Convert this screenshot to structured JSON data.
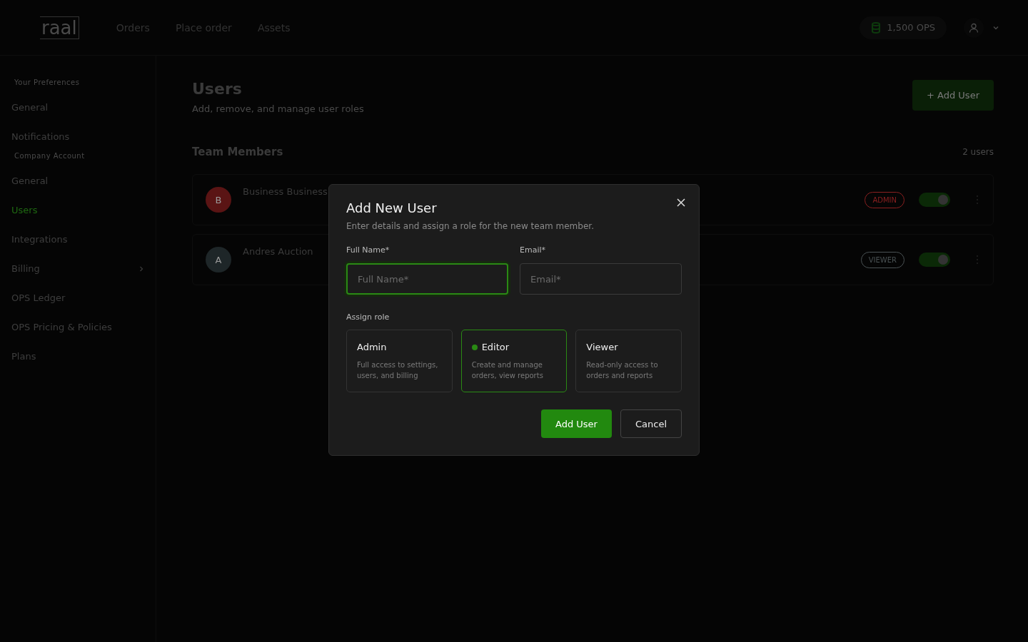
{
  "header": {
    "logo": "raal",
    "nav": [
      {
        "label": "Orders"
      },
      {
        "label": "Place order"
      },
      {
        "label": "Assets"
      }
    ],
    "credits": "1,500 OPS"
  },
  "sidebar": {
    "sections": [
      {
        "heading": "Your Preferences",
        "items": [
          {
            "label": "General",
            "selected": false,
            "expandable": false
          },
          {
            "label": "Notifications",
            "selected": false,
            "expandable": false
          }
        ]
      },
      {
        "heading": "Company Account",
        "items": [
          {
            "label": "General",
            "selected": false,
            "expandable": false
          },
          {
            "label": "Users",
            "selected": true,
            "expandable": false
          },
          {
            "label": "Integrations",
            "selected": false,
            "expandable": false
          },
          {
            "label": "Billing",
            "selected": false,
            "expandable": true
          },
          {
            "label": "OPS Ledger",
            "selected": false,
            "expandable": false
          },
          {
            "label": "OPS Pricing & Policies",
            "selected": false,
            "expandable": false
          },
          {
            "label": "Plans",
            "selected": false,
            "expandable": false
          }
        ]
      }
    ]
  },
  "page": {
    "title": "Users",
    "subtitle": "Add, remove, and manage user roles",
    "add_button": "+ Add User",
    "section_title": "Team Members",
    "count": "2 users",
    "members": [
      {
        "initial": "B",
        "name": "Business Business",
        "color": "#5a1414",
        "badge": {
          "text": "ADMIN",
          "color": "#8a2020"
        },
        "on": true
      },
      {
        "initial": "A",
        "name": "Andres Auction",
        "color": "#1e2628",
        "badge": {
          "text": "VIEWER",
          "color": "#4a5254"
        },
        "on": true
      }
    ]
  },
  "dialog": {
    "title": "Add New User",
    "subtitle": "Enter details and assign a role for the new team member.",
    "fields": [
      {
        "label": "Full Name*",
        "placeholder": "Full Name*",
        "focused": true
      },
      {
        "label": "Email*",
        "placeholder": "Email*",
        "focused": false
      }
    ],
    "role_label": "Assign role",
    "roles": [
      {
        "name": "Admin",
        "description": "Full access to settings, users, and billing",
        "selected": false
      },
      {
        "name": "Editor",
        "description": "Create and manage orders, view reports",
        "selected": true
      },
      {
        "name": "Viewer",
        "description": "Read-only access to orders and reports",
        "selected": false
      }
    ],
    "primary": "Add User",
    "secondary": "Cancel"
  }
}
